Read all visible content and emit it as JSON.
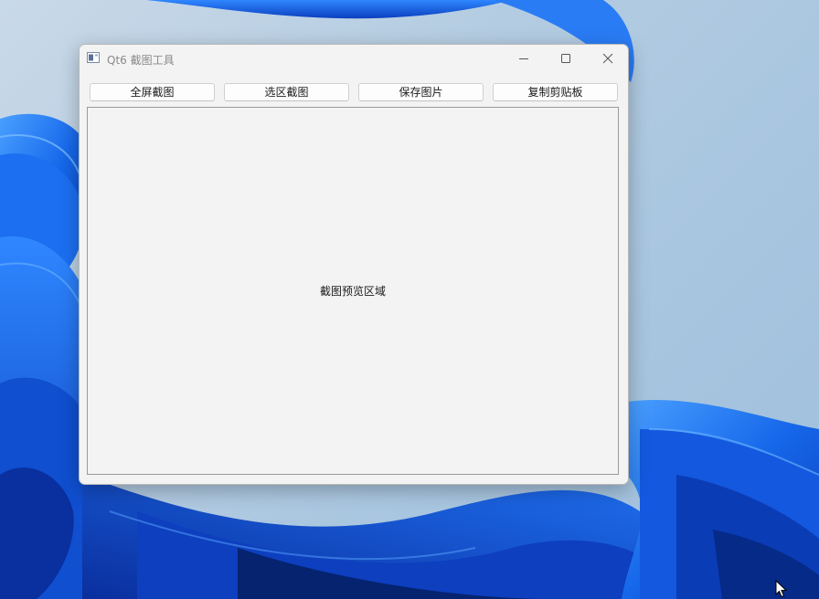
{
  "window": {
    "title": "Qt6 截图工具"
  },
  "toolbar": {
    "fullscreen_label": "全屏截图",
    "region_label": "选区截图",
    "save_label": "保存图片",
    "copy_label": "复制剪贴板"
  },
  "preview": {
    "label": "截图预览区域"
  },
  "icons": {
    "app": "window-app-icon",
    "minimize": "minimize-icon",
    "maximize": "maximize-icon",
    "close": "close-icon",
    "cursor": "mouse-cursor-icon"
  },
  "colors": {
    "wallpaper_blue": "#1565e8",
    "window_bg": "#f3f3f3"
  }
}
